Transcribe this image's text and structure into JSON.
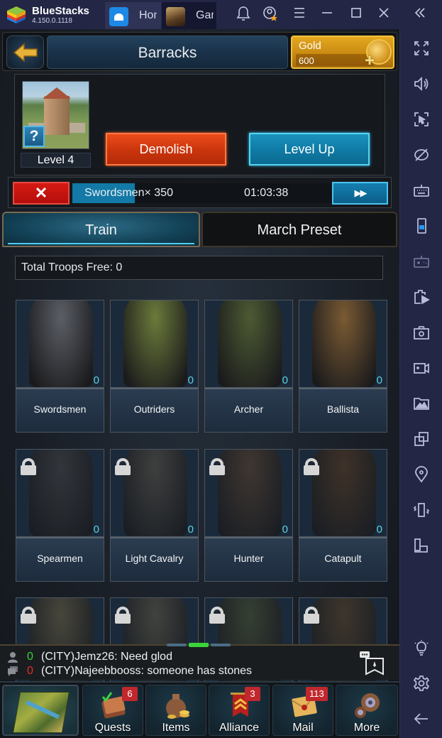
{
  "window": {
    "app_name": "BlueStacks",
    "version": "4.150.0.1118",
    "tabs": [
      {
        "label": "Home",
        "icon": "home-icon"
      },
      {
        "label": "Game",
        "icon": "game-app-icon"
      }
    ],
    "controls": [
      "bell-icon",
      "account-icon",
      "menu-icon",
      "minimize-icon",
      "maximize-icon",
      "close-icon",
      "collapse-sidebar-icon"
    ]
  },
  "sidebar": {
    "items": [
      {
        "name": "fullscreen",
        "icon": "fullscreen-icon"
      },
      {
        "name": "volume",
        "icon": "volume-icon"
      },
      {
        "name": "cursor-lock",
        "icon": "cursor-lock-icon"
      },
      {
        "name": "eco-mode",
        "icon": "eye-slash-icon"
      },
      {
        "name": "keyboard-controls",
        "icon": "keyboard-icon"
      },
      {
        "name": "device",
        "icon": "phone-icon"
      },
      {
        "name": "gamepad",
        "icon": "gamepad-icon"
      },
      {
        "name": "macro",
        "icon": "macro-icon"
      },
      {
        "name": "screenshot",
        "icon": "camera-icon"
      },
      {
        "name": "record",
        "icon": "video-icon"
      },
      {
        "name": "media",
        "icon": "gallery-icon"
      },
      {
        "name": "multi-instance",
        "icon": "multi-instance-icon"
      },
      {
        "name": "location",
        "icon": "location-icon"
      },
      {
        "name": "shake",
        "icon": "shake-icon"
      },
      {
        "name": "rotate",
        "icon": "rotate-icon"
      },
      {
        "name": "tips",
        "icon": "lightbulb-icon"
      },
      {
        "name": "settings",
        "icon": "gear-icon"
      },
      {
        "name": "back",
        "icon": "arrow-left-icon"
      }
    ]
  },
  "game": {
    "header": {
      "title": "Barracks",
      "gold_label": "Gold",
      "gold_value": "600"
    },
    "building": {
      "level_label": "Level 4",
      "help_label": "?",
      "demolish_label": "Demolish",
      "levelup_label": "Level Up"
    },
    "queue": {
      "cancel_label": "✕",
      "item_label": "Swordsmen× 350",
      "timer": "01:03:38",
      "progress_percent": 24,
      "speedup_label": "▶▶"
    },
    "tabs": [
      {
        "label": "Train",
        "active": true
      },
      {
        "label": "March Preset",
        "active": false
      }
    ],
    "troops_free": "Total Troops Free: 0",
    "troops": [
      {
        "name": "Swordsmen",
        "count": "0",
        "locked": false,
        "color": "#5b5e66"
      },
      {
        "name": "Outriders",
        "count": "0",
        "locked": false,
        "color": "#6b7a3a"
      },
      {
        "name": "Archer",
        "count": "0",
        "locked": false,
        "color": "#4c5a33"
      },
      {
        "name": "Ballista",
        "count": "0",
        "locked": false,
        "color": "#7a5a33"
      },
      {
        "name": "Spearmen",
        "count": "0",
        "locked": true,
        "color": "#3a3a3c"
      },
      {
        "name": "Light Cavalry",
        "count": "0",
        "locked": true,
        "color": "#4a4640"
      },
      {
        "name": "Hunter",
        "count": "0",
        "locked": true,
        "color": "#4b3a2e"
      },
      {
        "name": "Catapult",
        "count": "0",
        "locked": true,
        "color": "#4a3422"
      },
      {
        "name": "",
        "count": "",
        "locked": true,
        "color": "#57503c"
      },
      {
        "name": "",
        "count": "",
        "locked": true,
        "color": "#4e4b40"
      },
      {
        "name": "",
        "count": "",
        "locked": true,
        "color": "#3e4630"
      },
      {
        "name": "",
        "count": "",
        "locked": true,
        "color": "#4a3a28"
      }
    ],
    "chat": {
      "messages": [
        {
          "count": "0",
          "count_color": "#35d13a",
          "text": "(CITY)Jemz26: Need glod",
          "icon": "user-icon"
        },
        {
          "count": "0",
          "count_color": "#e32b2b",
          "text": "(CITY)Najeebbooss: someone has stones",
          "icon": "chat-bubbles-icon"
        }
      ]
    },
    "nav": [
      {
        "label": "Quests",
        "badge": "6",
        "icon": "quest-book-icon"
      },
      {
        "label": "Items",
        "badge": "",
        "icon": "item-bag-icon"
      },
      {
        "label": "Alliance",
        "badge": "3",
        "icon": "alliance-banner-icon"
      },
      {
        "label": "Mail",
        "badge": "113",
        "icon": "mail-envelope-icon"
      },
      {
        "label": "More",
        "badge": "",
        "icon": "more-gear-icon"
      }
    ]
  }
}
